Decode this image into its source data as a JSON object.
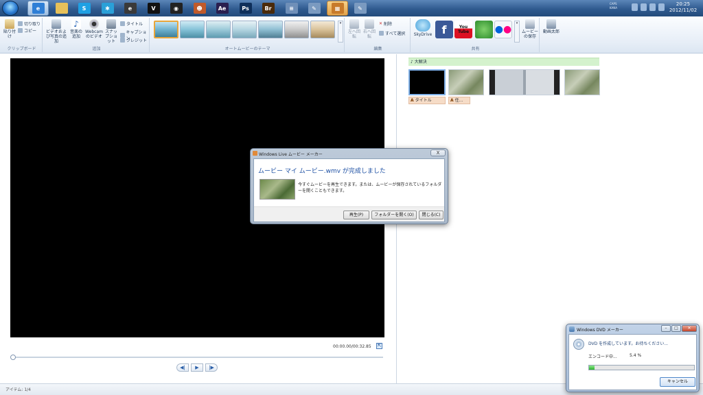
{
  "taskbar": {
    "apps": [
      {
        "name": "internet-explorer",
        "glyph": "e",
        "color": "#2f7fd6"
      },
      {
        "name": "file-explorer",
        "glyph": "",
        "color": "#e6c15a"
      },
      {
        "name": "skype",
        "glyph": "S",
        "color": "#1fa0e3"
      },
      {
        "name": "network-tool",
        "glyph": "✱",
        "color": "#2aa0d8"
      },
      {
        "name": "app-dark",
        "glyph": "e",
        "color": "#3a3a3a"
      },
      {
        "name": "app-v",
        "glyph": "V",
        "color": "#111111"
      },
      {
        "name": "media-app",
        "glyph": "◉",
        "color": "#222222"
      },
      {
        "name": "game-app",
        "glyph": "☻",
        "color": "#c05a2a"
      },
      {
        "name": "after-effects",
        "glyph": "Ae",
        "color": "#2a1f4f"
      },
      {
        "name": "photoshop",
        "glyph": "Ps",
        "color": "#0f2f5a"
      },
      {
        "name": "bridge",
        "glyph": "Br",
        "color": "#4a2a0a"
      },
      {
        "name": "document-app",
        "glyph": "≡",
        "color": "#6f8fb8"
      },
      {
        "name": "dvd-maker",
        "glyph": "✎",
        "color": "#7a9ac0"
      },
      {
        "name": "movie-maker",
        "glyph": "▦",
        "color": "#c77a2a"
      },
      {
        "name": "dvd-maker-2",
        "glyph": "✎",
        "color": "#7a9ac0"
      }
    ],
    "tray_text": "CAPS KANA",
    "clock_time": "20:25",
    "clock_date": "2012/11/02"
  },
  "ribbon": {
    "clipboard": {
      "paste": "貼り付け",
      "cut": "切り取り",
      "copy": "コピー",
      "label": "クリップボード"
    },
    "add": {
      "add_video": "ビデオおよび写真の追加",
      "add_music": "音楽の追加",
      "webcam": "Webcamのビデオ",
      "snapshot": "スナップショット",
      "title": "タイトル",
      "caption": "キャプション",
      "credit": "クレジット",
      "label": "追加"
    },
    "themes": {
      "label": "オートムービーのテーマ",
      "count": 7
    },
    "edit": {
      "rotate_left": "左へ回転",
      "rotate_right": "右へ回転",
      "remove": "削除",
      "select_all": "すべて選択",
      "label": "編集"
    },
    "share": {
      "skydrive": "SkyDrive",
      "facebook": "f",
      "youtube": "You Tube",
      "save_movie": "ムービーの保存",
      "label": "共有"
    },
    "video_tools": {
      "label": "動画太郎"
    }
  },
  "player": {
    "timecode": "00:00.00/00:32.85",
    "progress": 0.0
  },
  "storyboard": {
    "music_label": "♪ 大解決",
    "captions": [
      {
        "label": "タイトル"
      },
      {
        "label": "任…"
      }
    ]
  },
  "status": {
    "items": "アイテム: 1/4"
  },
  "dialog": {
    "title": "Windows Live ムービー メーカー",
    "close": "X",
    "heading": "ムービー マイ ムービー.wmv が完成しました",
    "message": "今すぐムービーを再生できます。または、ムービーが保存されているフォルダーを開くこともできます。",
    "buttons": {
      "play": "再生(P)",
      "open_folder": "フォルダーを開く(O)",
      "close": "閉じる(C)"
    }
  },
  "dvd": {
    "title": "Windows DVD メーカー",
    "message": "DVD を作成しています。お待ちください...",
    "status": "エンコード中...",
    "percent": "5.4 %",
    "progress": 0.054,
    "cancel": "キャンセル"
  }
}
